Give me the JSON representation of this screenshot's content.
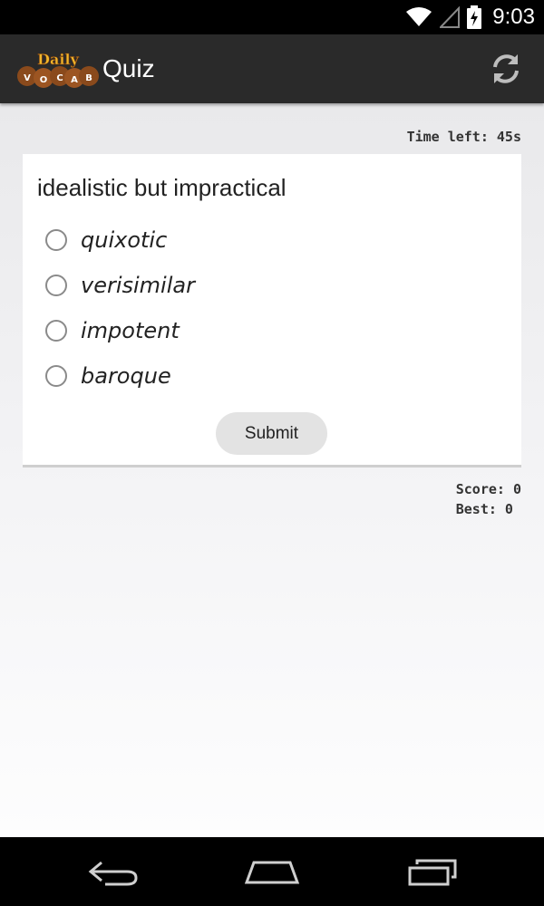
{
  "status_bar": {
    "time": "9:03",
    "icons": [
      "wifi-icon",
      "signal-icon",
      "battery-charging-icon"
    ]
  },
  "action_bar": {
    "logo_text": "Daily",
    "logo_letters": [
      "V",
      "O",
      "C",
      "A",
      "B"
    ],
    "title": "Quiz",
    "refresh_icon": "refresh-icon"
  },
  "quiz": {
    "timer": "Time left: 45s",
    "question": "idealistic but impractical",
    "options": [
      "quixotic",
      "verisimilar",
      "impotent",
      "baroque"
    ],
    "submit_label": "Submit",
    "score_text": "Score: 0",
    "best_text": "Best: 0"
  },
  "nav_bar": {
    "icons": [
      "back-icon",
      "home-icon",
      "recent-apps-icon"
    ]
  }
}
